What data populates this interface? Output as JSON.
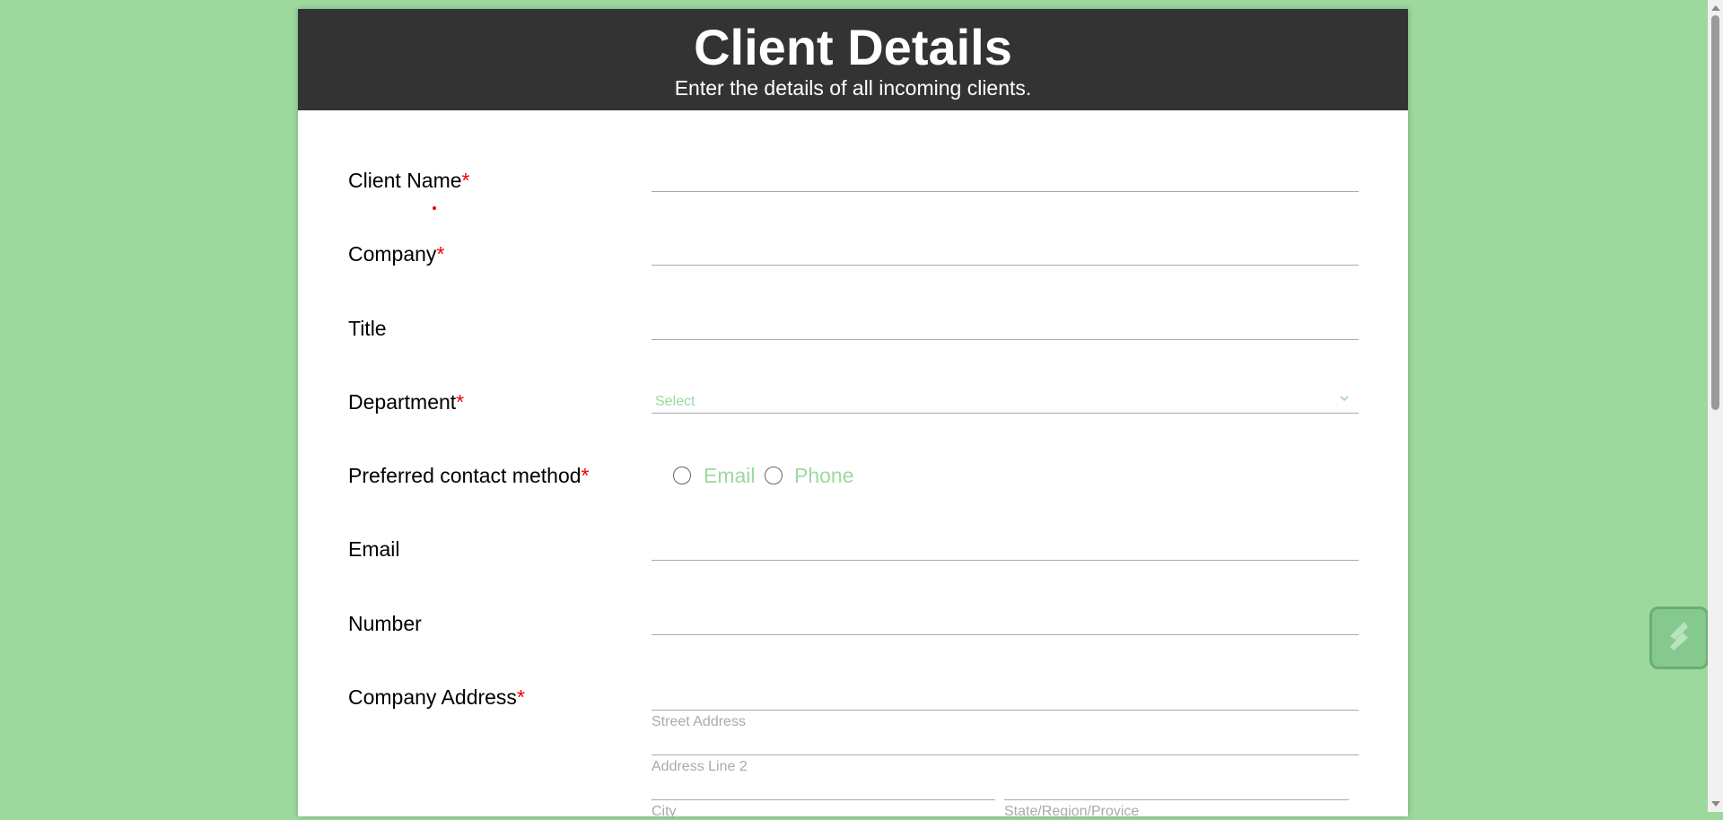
{
  "header": {
    "title": "Client Details",
    "subtitle": "Enter the details of all incoming clients."
  },
  "form": {
    "required_mark": "*",
    "client_name": {
      "label": "Client Name",
      "value": ""
    },
    "company": {
      "label": "Company",
      "value": ""
    },
    "title": {
      "label": "Title",
      "value": ""
    },
    "department": {
      "label": "Department",
      "placeholder": "Select"
    },
    "contact_method": {
      "label": "Preferred contact method",
      "options": [
        "Email",
        "Phone"
      ]
    },
    "email": {
      "label": "Email",
      "value": ""
    },
    "number": {
      "label": "Number",
      "value": ""
    },
    "company_address": {
      "label": "Company Address",
      "street_caption": "Street Address",
      "line2_caption": "Address Line 2",
      "city_caption": "City",
      "state_caption": "State/Region/Provice"
    }
  },
  "colors": {
    "background": "#9dd99d",
    "header": "#333333",
    "required": "#ee0000",
    "placeholder_green": "#9dd99d"
  },
  "icons": {
    "dropdown": "chevron-down-icon",
    "widget": "slash-logo-icon"
  }
}
